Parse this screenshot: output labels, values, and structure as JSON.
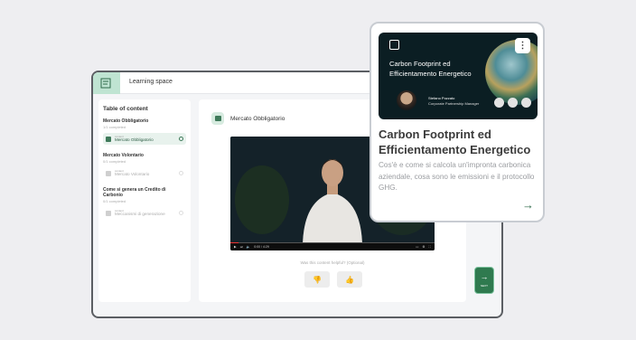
{
  "app": {
    "title": "Learning space"
  },
  "sidebar": {
    "title": "Table of content",
    "sections": [
      {
        "title": "Mercato Obbligatorio",
        "progress": "1/1 completed",
        "item": {
          "type": "content",
          "name": "Mercato Obbligatorio"
        }
      },
      {
        "title": "Mercato Volontario",
        "progress": "0/1 completed",
        "item": {
          "type": "content",
          "name": "Mercato Volontario"
        }
      },
      {
        "title": "Come si genera un Credito di Carbonio",
        "progress": "0/1 completed",
        "item": {
          "type": "content",
          "name": "Meccanismi di generazione"
        }
      }
    ]
  },
  "main": {
    "title": "Mercato Obbligatorio",
    "video_time": "0:00 / 4:29",
    "feedback_prompt": "Was this content helpful? (Optional)"
  },
  "next_button": {
    "label": "NEXT"
  },
  "card": {
    "thumb_title": "Carbon Footprint ed Efficientamento Energetico",
    "speaker_name": "Stefano Pozzato",
    "speaker_role": "Corporate Partnership Manager",
    "title": "Carbon Footprint ed Efficientamento Energetico",
    "description": "Cos'è e come si calcola un'impronta carbonica aziendale, cosa sono le emissioni e il protocollo GHG."
  },
  "colors": {
    "accent": "#2f7a4f",
    "accent_light": "#bfe4d2"
  }
}
